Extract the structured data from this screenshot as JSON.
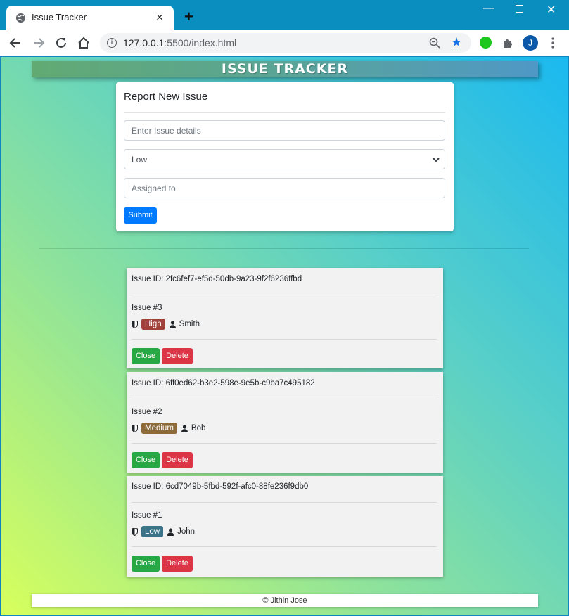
{
  "browser": {
    "tab_title": "Issue Tracker",
    "url_host": "127.0.0.1",
    "url_port_path": ":5500/index.html",
    "profile_initial": "J"
  },
  "header": {
    "title": "ISSUE TRACKER"
  },
  "report": {
    "title": "Report New Issue",
    "details_placeholder": "Enter Issue details",
    "severity_selected": "Low",
    "assigned_placeholder": "Assigned to",
    "submit_label": "Submit"
  },
  "issues": [
    {
      "id_text": "Issue ID: 2fc6fef7-ef5d-50db-9a23-9f2f6236ffbd",
      "number": "Issue #3",
      "severity": "High",
      "assignee": "Smith",
      "close_label": "Close",
      "delete_label": "Delete"
    },
    {
      "id_text": "Issue ID: 6ff0ed62-b3e2-598e-9e5b-c9ba7c495182",
      "number": "Issue #2",
      "severity": "Medium",
      "assignee": "Bob",
      "close_label": "Close",
      "delete_label": "Delete"
    },
    {
      "id_text": "Issue ID: 6cd7049b-5fbd-592f-afc0-88fe236f9db0",
      "number": "Issue #1",
      "severity": "Low",
      "assignee": "John",
      "close_label": "Close",
      "delete_label": "Delete"
    }
  ],
  "footer": {
    "text": "© Jithin Jose"
  },
  "colors": {
    "severity_high": "#a1413b",
    "severity_medium": "#8d6a39",
    "severity_low": "#3a7388",
    "close_button": "#28a745",
    "delete_button": "#dc3545",
    "submit_button": "#007bff"
  }
}
